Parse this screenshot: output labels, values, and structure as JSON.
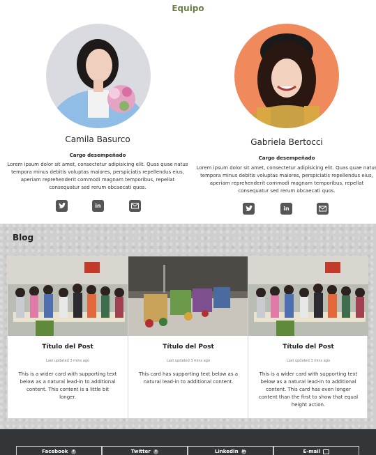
{
  "team": {
    "title": "Equipo",
    "members": [
      {
        "name": "Camila Basurco",
        "role": "Cargo desempeñado",
        "description": "Lorem ipsum dolor sit amet, consectetur adipisicing elit. Quas quae natus tempora minus debitis voluptas maiores, perspiciatis repellendus eius, aperiam reprehenderit commodi magnam temporibus, repellat consequatur sed rerum obcaecati quos.",
        "socials": [
          "twitter-icon",
          "linkedin-icon",
          "email-icon"
        ]
      },
      {
        "name": "Gabriela Bertocci",
        "role": "Cargo desempeñado",
        "description": "Lorem ipsum dolor sit amet, consectetur adipisicing elit. Quas quae natus tempora minus debitis voluptas maiores, perspiciatis repellendus eius, aperiam reprehenderit commodi magnam temporibus, repellat consequatur sed rerum obcaecati quos.",
        "socials": [
          "twitter-icon",
          "linkedin-icon",
          "email-icon"
        ]
      }
    ]
  },
  "blog": {
    "title": "Blog",
    "cards": [
      {
        "title": "Título del Post",
        "updated": "Last updated 3 mins ago",
        "text": "This is a wider card with supporting text below as a natural lead-in to additional content. This content is a little bit longer."
      },
      {
        "title": "Título del Post",
        "updated": "Last updated 3 mins ago",
        "text": "This card has supporting text below as a natural lead-in to additional content."
      },
      {
        "title": "Título del Post",
        "updated": "Last updated 3 mins ago",
        "text": "This is a wider card with supporting text below as a natural lead-in to additional content. This card has even longer content than the first to show that equal height action."
      }
    ]
  },
  "footer": {
    "links": [
      {
        "label": "Facebook",
        "icon": "facebook-icon"
      },
      {
        "label": "Twitter",
        "icon": "twitter-icon"
      },
      {
        "label": "LinkedIn",
        "icon": "linkedin-icon"
      },
      {
        "label": "E-mail",
        "icon": "email-icon"
      }
    ]
  },
  "colors": {
    "team_title": "#6a7d4a",
    "social_icon_bg": "#555555",
    "footer_bg": "#333638",
    "blog_bg": "#cfcfcf"
  }
}
